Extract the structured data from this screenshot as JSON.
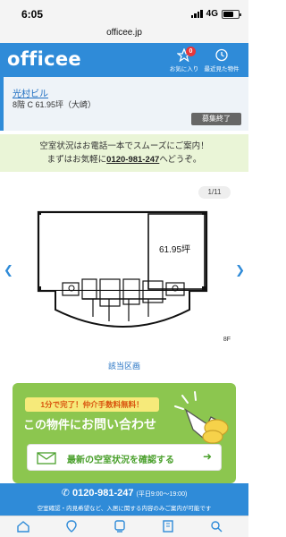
{
  "status_bar": {
    "time": "6:05",
    "network": "4G"
  },
  "browser": {
    "url": "officee.jp"
  },
  "header": {
    "logo": "officee",
    "favorites_label": "お気に入り",
    "favorites_count": "0",
    "recent_label": "最近見た物件"
  },
  "property": {
    "name": "光村ビル",
    "detail": "8階 C 61.95坪（大崎）",
    "status_label": "募集終了"
  },
  "notice": {
    "line1": "空室状況はお電話一本でスムーズにご案内！",
    "line2_prefix": "まずはお気軽に",
    "phone": "0120-981-247",
    "line2_suffix": "へどうぞ。"
  },
  "floorplan": {
    "counter": "1/11",
    "area_label": "61.95坪",
    "floor": "8F",
    "caption": "該当区画"
  },
  "inquiry": {
    "pill": "1分で完了！仲介手数料無料！",
    "title_prefix": "この物件に",
    "title_emph": "お問い合わせ",
    "button_label": "最新の空室状況を確認する"
  },
  "call_bar": {
    "phone": "0120-981-247",
    "hours": "(平日9:00〜19:00)",
    "sub": "空室確認・内見希望など、入居に関する内容のみご案内が可能です"
  },
  "colors": {
    "brand": "#2f8bd8",
    "green": "#8cc64f",
    "notice_bg": "#eaf5d7"
  }
}
